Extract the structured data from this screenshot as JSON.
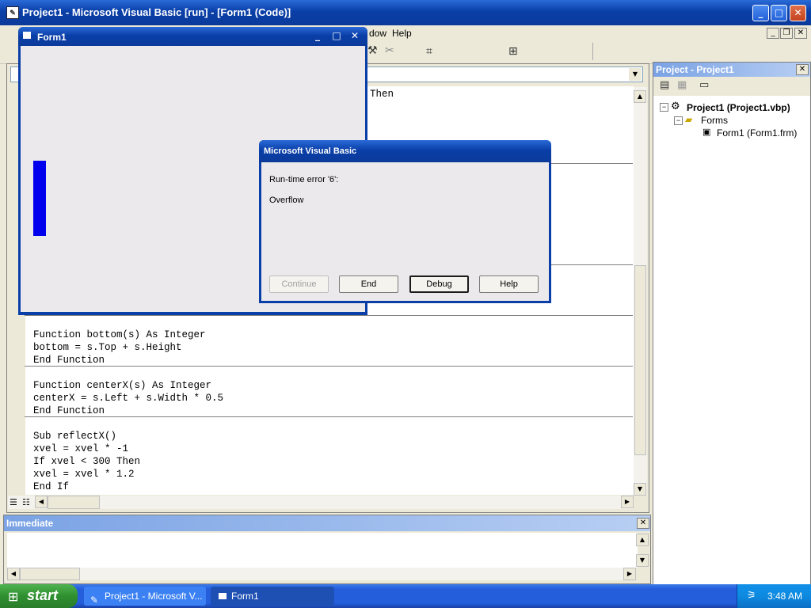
{
  "main_window": {
    "title": "Project1 - Microsoft Visual Basic [run] - [Form1 (Code)]"
  },
  "menu": {
    "items": [
      "dow",
      "Help"
    ]
  },
  "code_editor": {
    "line_then": "Then",
    "block_bottom": [
      "Function bottom(s) As Integer",
      "bottom = s.Top + s.Height",
      "End Function"
    ],
    "block_centerx": [
      "Function centerX(s) As Integer",
      "centerX = s.Left + s.Width * 0.5",
      "End Function"
    ],
    "block_reflect": [
      "Sub reflectX()",
      "xvel = xvel * -1",
      "If xvel < 300 Then",
      "xvel = xvel * 1.2",
      "End If"
    ]
  },
  "form1": {
    "title": "Form1",
    "paddle_color": "#0000ee"
  },
  "error_dialog": {
    "title": "Microsoft Visual Basic",
    "error_line": "Run-time error '6':",
    "message": "Overflow",
    "buttons": {
      "continue": "Continue",
      "end": "End",
      "debug": "Debug",
      "help": "Help"
    }
  },
  "project_explorer": {
    "title": "Project - Project1",
    "root": "Project1 (Project1.vbp)",
    "folder": "Forms",
    "item": "Form1 (Form1.frm)"
  },
  "immediate": {
    "title": "Immediate"
  },
  "taskbar": {
    "start": "start",
    "tasks": [
      "Project1 - Microsoft V...",
      "Form1"
    ],
    "clock": "3:48 AM"
  },
  "colors": {
    "xp_blue": "#0a3fa8",
    "panel_title_blue": "#7aa2e4"
  }
}
